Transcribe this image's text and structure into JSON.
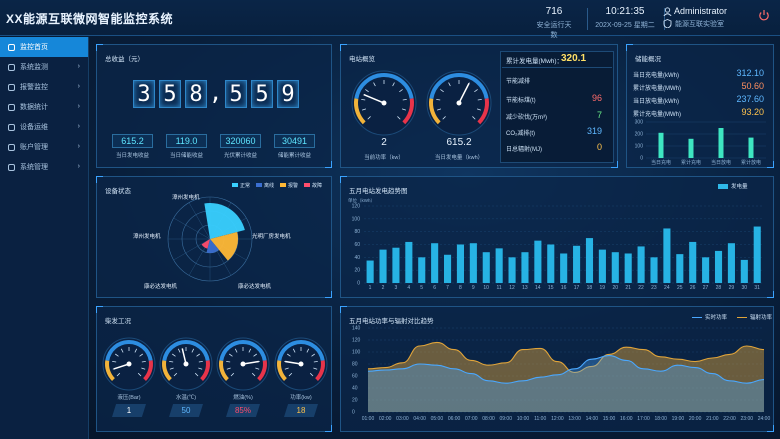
{
  "header": {
    "title": "XX能源互联微网智能监控系统",
    "days_value": "716",
    "days_label": "安全运行天数",
    "time": "10:21:35",
    "date": "202X-09-25 星期二",
    "user": "Administrator",
    "lab": "能源互联实验室"
  },
  "sidebar": {
    "items": [
      {
        "label": "监控首页"
      },
      {
        "label": "系统监测"
      },
      {
        "label": "报警监控"
      },
      {
        "label": "数据统计"
      },
      {
        "label": "设备运维"
      },
      {
        "label": "账户管理"
      },
      {
        "label": "系统管理"
      }
    ]
  },
  "revenue": {
    "title": "总收益（元）",
    "digits": [
      "3",
      "5",
      "8",
      "5",
      "5",
      "9"
    ],
    "comma": ",",
    "items": [
      {
        "value": "615.2",
        "label": "当日发电收益"
      },
      {
        "value": "119.0",
        "label": "当日储能收益"
      },
      {
        "value": "320060",
        "label": "光伏累计收益"
      },
      {
        "value": "30491",
        "label": "储能累计收益"
      }
    ]
  },
  "station": {
    "title": "电站概览",
    "gauges": [
      {
        "value": "2",
        "label": "当前功率（kw）",
        "needle": 25
      },
      {
        "value": "615.2",
        "label": "当日发电量（kwh）",
        "needle": 60
      }
    ],
    "total_label": "累计发电量(Mwh)：",
    "total_value": "320.1",
    "rows": [
      {
        "label": "节能减排",
        "value": "",
        "color": "#ffffff"
      },
      {
        "label": "节能标煤(t)",
        "value": "96",
        "color": "#ff6b6b"
      },
      {
        "label": "减少砍伐(万m³)",
        "value": "7",
        "color": "#6cf08b"
      },
      {
        "label": "CO₂减排(t)",
        "value": "319",
        "color": "#5fb8ff"
      },
      {
        "label": "日总辐射(MJ)",
        "value": "0",
        "color": "#ffc34d"
      }
    ]
  },
  "storage": {
    "title": "储能概况",
    "rows": [
      {
        "label": "当日充电量(kWh)",
        "value": "312.10",
        "color": "#5fb8ff"
      },
      {
        "label": "累计放电量(MWh)",
        "value": "50.60",
        "color": "#ff8f5f"
      },
      {
        "label": "当日放电量(kWh)",
        "value": "237.60",
        "color": "#5fb8ff"
      },
      {
        "label": "累计充电量(MWh)",
        "value": "93.20",
        "color": "#ffc34d"
      }
    ],
    "chart": {
      "type": "bar",
      "categories": [
        "当日充电",
        "累计充电",
        "当日放电",
        "累计放电"
      ],
      "values": [
        210,
        160,
        250,
        170
      ],
      "yticks": [
        "300",
        "200",
        "100",
        "0"
      ]
    }
  },
  "device": {
    "title": "设备状态",
    "legend": [
      {
        "name": "正常",
        "color": "#39d0ff"
      },
      {
        "name": "离线",
        "color": "#3b6fd1"
      },
      {
        "name": "报警",
        "color": "#ffb836"
      },
      {
        "name": "故障",
        "color": "#ff4d6d"
      }
    ],
    "labels": [
      "漳州发电机",
      "光明厂房发电机",
      "漳州发电机",
      "康必达发电机",
      "康必达发电机"
    ]
  },
  "daily": {
    "title": "五月电站发电趋势图",
    "unit": "单位（kWh）",
    "legend": "发电量",
    "chart_data": {
      "type": "bar",
      "categories": [
        "1",
        "2",
        "3",
        "4",
        "5",
        "6",
        "7",
        "8",
        "9",
        "10",
        "11",
        "12",
        "13",
        "14",
        "15",
        "16",
        "17",
        "18",
        "19",
        "20",
        "21",
        "22",
        "23",
        "24",
        "25",
        "26",
        "27",
        "28",
        "29",
        "30",
        "31"
      ],
      "values": [
        35,
        52,
        55,
        64,
        40,
        62,
        44,
        60,
        62,
        48,
        54,
        40,
        48,
        66,
        60,
        46,
        58,
        70,
        52,
        48,
        46,
        57,
        40,
        85,
        45,
        64,
        40,
        50,
        62,
        36,
        88
      ],
      "ylim": [
        0,
        120
      ],
      "yticks": [
        "120",
        "100",
        "80",
        "60",
        "40",
        "20",
        "0"
      ]
    }
  },
  "boiler": {
    "title": "柴发工况",
    "gauges": [
      {
        "label": "液压(Bar)",
        "value": "1",
        "color": "#ffffff",
        "needle": 10
      },
      {
        "label": "水温(℃)",
        "value": "50",
        "color": "#5fb8ff",
        "needle": 45
      },
      {
        "label": "燃油(%)",
        "value": "85%",
        "color": "#ff4d6d",
        "needle": 80
      },
      {
        "label": "功率(kw)",
        "value": "18",
        "color": "#ffc34d",
        "needle": 20
      }
    ]
  },
  "power": {
    "title": "五月电站功率与辐射对比趋势",
    "legend": [
      {
        "name": "实时功率",
        "color": "#4aa8ff"
      },
      {
        "name": "辐射功率",
        "color": "#e0a43a"
      }
    ],
    "chart_data": {
      "type": "area",
      "x": [
        "01:00",
        "02:00",
        "03:00",
        "04:00",
        "05:00",
        "06:00",
        "07:00",
        "08:00",
        "09:00",
        "10:00",
        "11:00",
        "12:00",
        "13:00",
        "14:00",
        "15:00",
        "16:00",
        "17:00",
        "18:00",
        "19:00",
        "20:00",
        "21:00",
        "22:00",
        "23:00",
        "24:00"
      ],
      "series": [
        {
          "name": "实时功率",
          "values": [
            68,
            70,
            72,
            80,
            78,
            72,
            64,
            52,
            48,
            52,
            58,
            62,
            72,
            88,
            94,
            86,
            72,
            68,
            78,
            74,
            64,
            52,
            48,
            54
          ]
        },
        {
          "name": "辐射功率",
          "values": [
            72,
            74,
            82,
            110,
            116,
            104,
            86,
            78,
            82,
            104,
            106,
            84,
            66,
            76,
            96,
            108,
            104,
            92,
            88,
            84,
            90,
            96,
            110,
            104
          ]
        }
      ],
      "ylim": [
        0,
        140
      ],
      "yticks": [
        "140",
        "120",
        "100",
        "80",
        "60",
        "40",
        "20",
        "0"
      ]
    }
  }
}
